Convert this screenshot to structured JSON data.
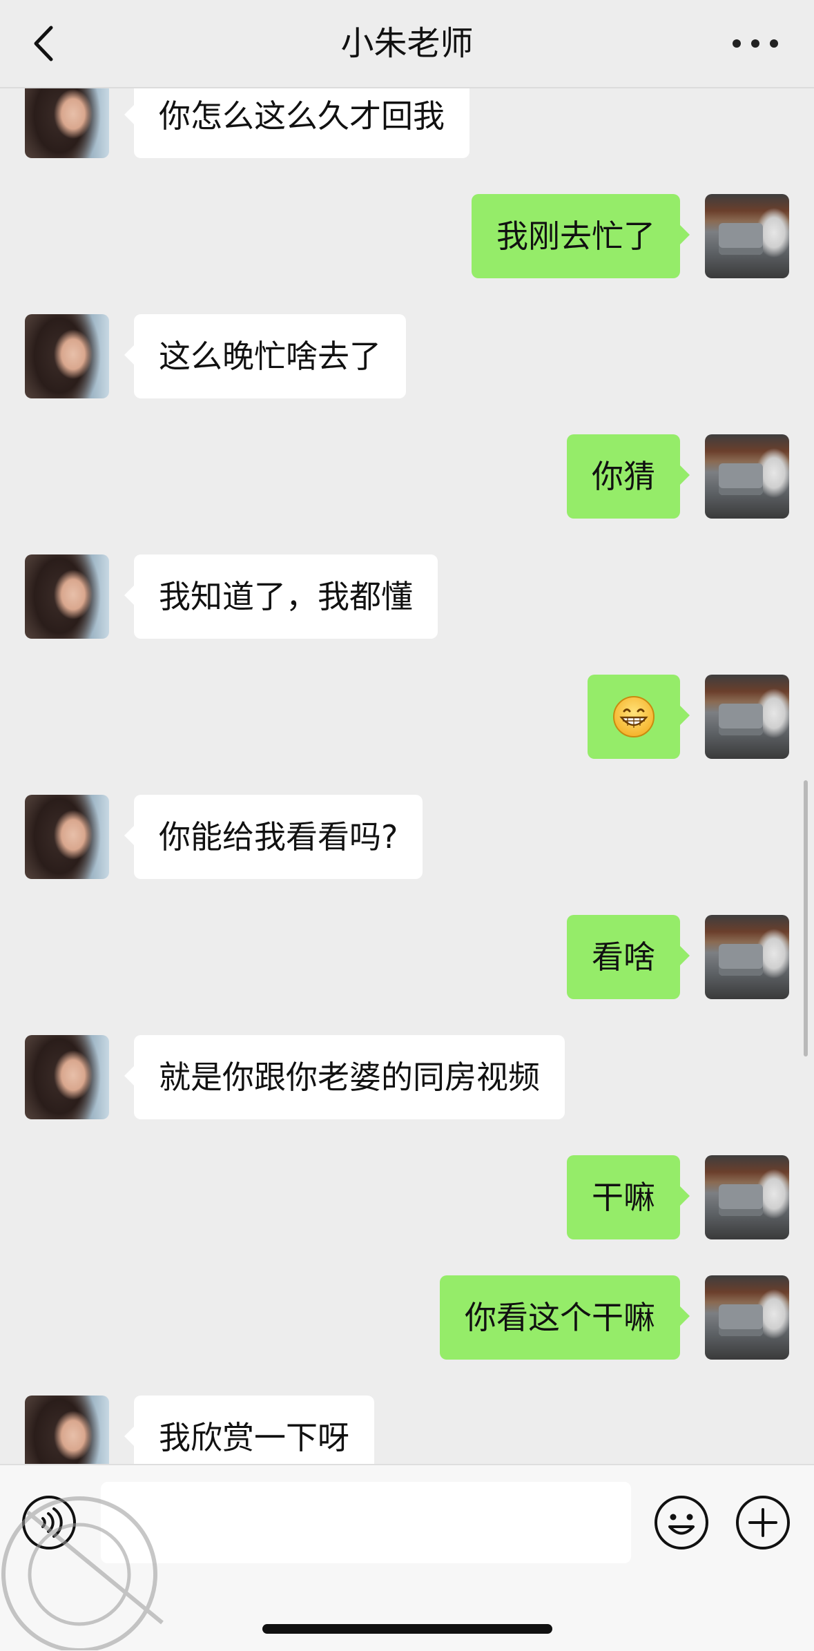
{
  "header": {
    "title": "小朱老师",
    "back_icon": "chevron-left-icon",
    "more_icon": "more-dots-icon"
  },
  "messages": [
    {
      "side": "in",
      "text": "你怎么这么久才回我"
    },
    {
      "side": "out",
      "text": "我刚去忙了"
    },
    {
      "side": "in",
      "text": "这么晚忙啥去了"
    },
    {
      "side": "out",
      "text": "你猜"
    },
    {
      "side": "in",
      "text": "我知道了，我都懂"
    },
    {
      "side": "out",
      "emoji": "grinning-face-icon"
    },
    {
      "side": "in",
      "text": "你能给我看看吗?"
    },
    {
      "side": "out",
      "text": "看啥"
    },
    {
      "side": "in",
      "text": "就是你跟你老婆的同房视频"
    },
    {
      "side": "out",
      "text": "干嘛"
    },
    {
      "side": "out",
      "text": "你看这个干嘛"
    },
    {
      "side": "in",
      "text": "我欣赏一下呀"
    }
  ],
  "input_bar": {
    "voice_icon": "voice-icon",
    "text_value": "",
    "emoji_icon": "smiley-icon",
    "plus_icon": "plus-circle-icon"
  },
  "colors": {
    "background": "#ededed",
    "outgoing_bubble": "#95ec69",
    "incoming_bubble": "#ffffff"
  }
}
